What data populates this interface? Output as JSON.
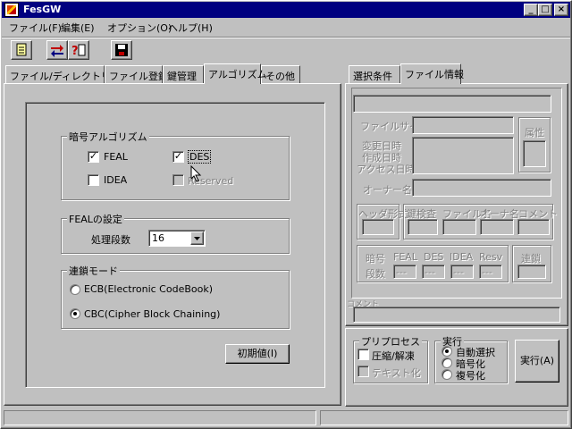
{
  "window": {
    "title": "FesGW",
    "controls": [
      "_",
      "□",
      "×"
    ]
  },
  "menu": [
    "ファイル(F)",
    "編集(E)",
    "オプション(O)",
    "ヘルプ(H)"
  ],
  "toolbar": {
    "icons": [
      "document-icon",
      "transfer-icon",
      "help-icon",
      "disk-icon"
    ]
  },
  "left_tabs": [
    "ファイル/ディレクトリ選択",
    "ファイル登録",
    "鍵管理",
    "アルゴリズム",
    "その他"
  ],
  "algorithm": {
    "group_title": "暗号アルゴリズム",
    "checks": [
      {
        "label": "FEAL",
        "checked": true
      },
      {
        "label": "DES",
        "checked": true
      },
      {
        "label": "IDEA",
        "checked": false
      },
      {
        "label": "Reserved",
        "checked": false
      }
    ]
  },
  "feal": {
    "group_title": "FEALの設定",
    "stages_label": "処理段数",
    "stages_value": "16"
  },
  "chain": {
    "group_title": "連鎖モード",
    "options": [
      {
        "label": "ECB(Electronic CodeBook)",
        "selected": false
      },
      {
        "label": "CBC(Cipher Block Chaining)",
        "selected": true
      }
    ]
  },
  "init_button": "初期値(I)",
  "right_tabs": [
    "選択条件",
    "ファイル情報"
  ],
  "fileinfo": {
    "size_label": "ファイルサイズ",
    "attr_label": "属性",
    "modified_label": "変更日時",
    "created_label": "作成日時",
    "accessed_label": "アクセス日時",
    "owner_label": "オーナー名",
    "header_label": "ヘッダ形式",
    "keycheck_label": "鍵検査",
    "filename_label": "ファイル名",
    "ownername_label": "オーナ名",
    "comment_label": "コメント",
    "cipher_label": "暗号",
    "stages_label": "段数",
    "algos": [
      "FEAL",
      "DES",
      "IDEA",
      "Resv"
    ],
    "algo_values": [
      "---",
      "---",
      "---",
      "---"
    ],
    "chain_label": "連鎖"
  },
  "comment_label": "コメント",
  "preprocess": {
    "group_title": "プリプロセス",
    "options": [
      "圧縮/解凍",
      "テキスト化"
    ]
  },
  "execute": {
    "group_title": "実行",
    "options": [
      {
        "label": "自動選択",
        "selected": true
      },
      {
        "label": "暗号化",
        "selected": false
      },
      {
        "label": "複号化",
        "selected": false
      }
    ],
    "button": "実行(A)"
  }
}
